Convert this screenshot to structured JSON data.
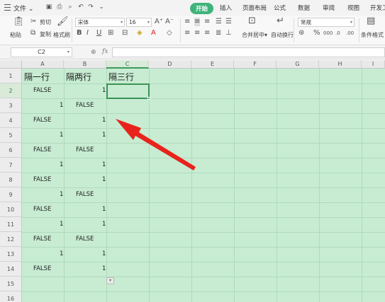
{
  "titlebar": {
    "file_menu": "文件",
    "tabs": [
      "开始",
      "插入",
      "页面布局",
      "公式",
      "数据",
      "审阅",
      "视图",
      "开发工"
    ]
  },
  "ribbon": {
    "paste": "粘贴",
    "cut": "剪切",
    "copy": "复制",
    "format_painter": "格式刷",
    "font_name": "宋体",
    "font_size": "16",
    "merge_center": "合并居中",
    "wrap_text": "自动换行",
    "number_format": "常规",
    "conditional_format": "条件格式"
  },
  "formula_bar": {
    "name_box": "C2",
    "fx": "fx",
    "formula": ""
  },
  "sheet": {
    "columns": [
      "A",
      "B",
      "C",
      "D",
      "E",
      "F",
      "G",
      "H",
      "I"
    ],
    "selected_column": "C",
    "rows": [
      "1",
      "2",
      "3",
      "4",
      "5",
      "6",
      "7",
      "8",
      "9",
      "10",
      "11",
      "12",
      "13",
      "14",
      "15",
      "16"
    ],
    "selected_row": "2",
    "headers": {
      "A1": "隔一行",
      "B1": "隔两行",
      "C1": "隔三行"
    },
    "cells": {
      "A2": "FALSE",
      "B2": "1",
      "A3": "1",
      "B3": "FALSE",
      "A4": "FALSE",
      "B4": "1",
      "A5": "1",
      "B5": "1",
      "A6": "FALSE",
      "B6": "FALSE",
      "A7": "1",
      "B7": "1",
      "A8": "FALSE",
      "B8": "1",
      "A9": "1",
      "B9": "FALSE",
      "A10": "FALSE",
      "B10": "1",
      "A11": "1",
      "B11": "1",
      "A12": "FALSE",
      "B12": "FALSE",
      "A13": "1",
      "B13": "1",
      "A14": "FALSE",
      "B14": "1"
    },
    "selected_cell": "C2"
  },
  "colors": {
    "sheet_fill": "#c7ecd2",
    "accent": "#3fb47a",
    "selection": "#3a9356",
    "arrow": "#e8231c"
  }
}
